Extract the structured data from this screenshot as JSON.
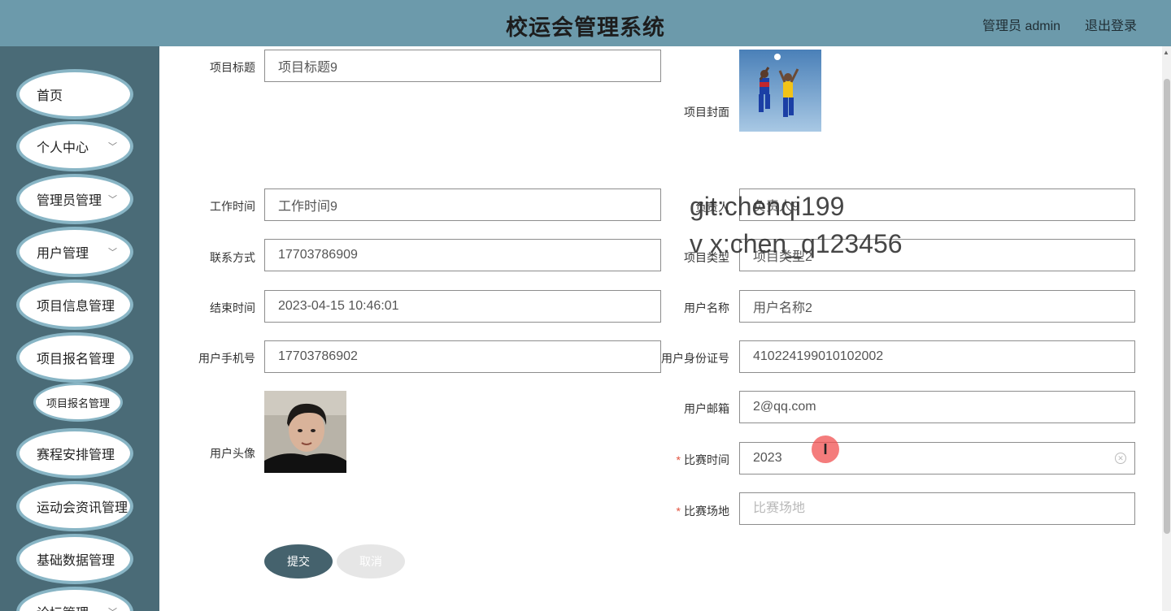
{
  "header": {
    "title": "校运会管理系统",
    "admin_label": "管理员 admin",
    "logout_label": "退出登录"
  },
  "sidebar": {
    "items": [
      {
        "label": "首页",
        "has_chevron": false
      },
      {
        "label": "个人中心",
        "has_chevron": true
      },
      {
        "label": "管理员管理",
        "has_chevron": true
      },
      {
        "label": "用户管理",
        "has_chevron": true
      },
      {
        "label": "项目信息管理",
        "has_chevron": true
      },
      {
        "label": "项目报名管理",
        "has_chevron": true
      },
      {
        "label": "赛程安排管理",
        "has_chevron": true
      },
      {
        "label": "运动会资讯管理",
        "has_chevron": true
      },
      {
        "label": "基础数据管理",
        "has_chevron": true
      },
      {
        "label": "论坛管理",
        "has_chevron": true
      }
    ],
    "subitem": "项目报名管理"
  },
  "form": {
    "project_title": {
      "label": "项目标题",
      "value": "项目标题9"
    },
    "project_cover": {
      "label": "项目封面"
    },
    "work_time": {
      "label": "工作时间",
      "value": "工作时间9"
    },
    "person_in_charge": {
      "label": "负责人",
      "value": "负责人9"
    },
    "contact": {
      "label": "联系方式",
      "value": "17703786909"
    },
    "project_type": {
      "label": "项目类型",
      "value": "项目类型2"
    },
    "end_time": {
      "label": "结束时间",
      "value": "2023-04-15 10:46:01"
    },
    "user_name": {
      "label": "用户名称",
      "value": "用户名称2"
    },
    "user_phone": {
      "label": "用户手机号",
      "value": "17703786902"
    },
    "user_id_card": {
      "label": "用户身份证号",
      "value": "410224199010102002"
    },
    "user_avatar": {
      "label": "用户头像"
    },
    "user_email": {
      "label": "用户邮箱",
      "value": "2@qq.com"
    },
    "match_time": {
      "label": "比赛时间",
      "value": "2023",
      "required": "*"
    },
    "match_venue": {
      "label": "比赛场地",
      "placeholder": "比赛场地",
      "required": "*"
    }
  },
  "buttons": {
    "submit": "提交",
    "cancel": "取消"
  },
  "watermark": {
    "line1": "git:chenqi199",
    "line2": "v x:chen_q123456"
  },
  "cursor": {
    "glyph": "I"
  }
}
